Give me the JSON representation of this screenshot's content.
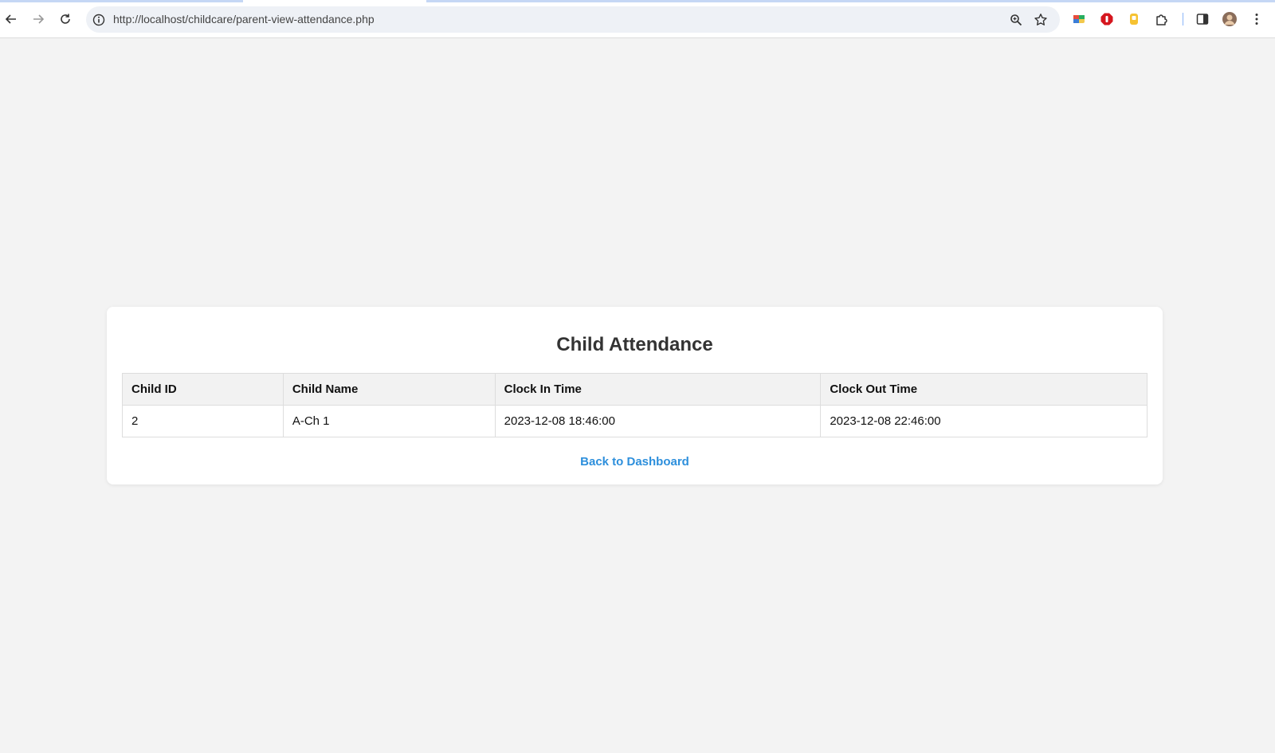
{
  "browser": {
    "url": "http://localhost/childcare/parent-view-attendance.php"
  },
  "page": {
    "title": "Child Attendance",
    "table": {
      "headers": [
        "Child ID",
        "Child Name",
        "Clock In Time",
        "Clock Out Time"
      ],
      "rows": [
        [
          "2",
          "A-Ch 1",
          "2023-12-08 18:46:00",
          "2023-12-08 22:46:00"
        ]
      ]
    },
    "back_link": "Back to Dashboard"
  },
  "colors": {
    "background": "#f3f3f3",
    "card": "#ffffff",
    "link": "#2d8fdc",
    "header_row": "#f2f2f2"
  }
}
